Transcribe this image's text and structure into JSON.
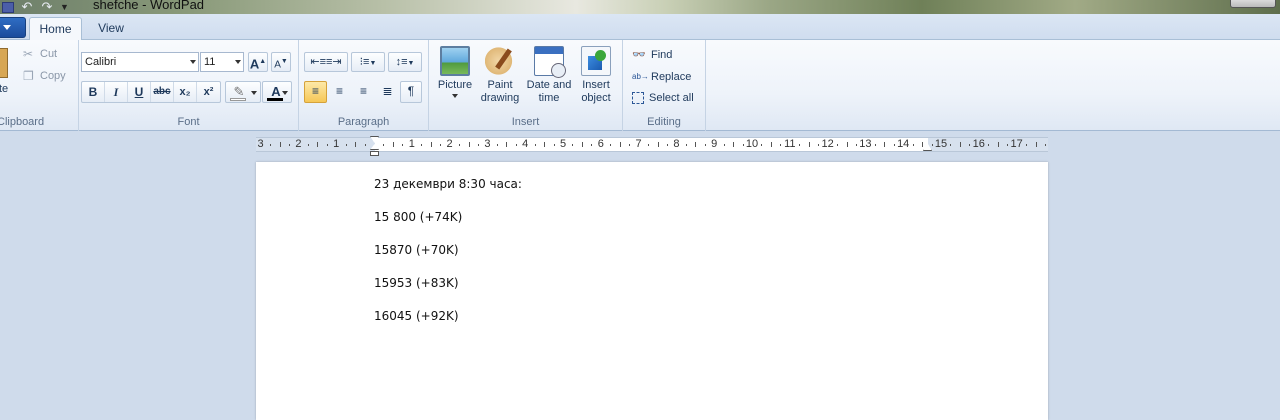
{
  "window": {
    "title": "shefche - WordPad"
  },
  "tabs": [
    {
      "label": "Home"
    },
    {
      "label": "View"
    }
  ],
  "clipboard": {
    "paste_label": "te",
    "cut_label": "Cut",
    "copy_label": "Copy",
    "group_label": "Clipboard"
  },
  "font": {
    "family_value": "Calibri",
    "size_value": "11",
    "grow_label": "A",
    "shrink_label": "A",
    "bold": "B",
    "italic": "I",
    "underline": "U",
    "strike": "abc",
    "subscript": "x₂",
    "superscript": "x²",
    "color_glyph": "A",
    "highlight_color": "#ffffff",
    "text_color": "#000000",
    "group_label": "Font"
  },
  "paragraph": {
    "group_label": "Paragraph"
  },
  "insert": {
    "picture_label_1": "Picture",
    "paint_label_1": "Paint",
    "paint_label_2": "drawing",
    "date_label_1": "Date and",
    "date_label_2": "time",
    "object_label_1": "Insert",
    "object_label_2": "object",
    "group_label": "Insert"
  },
  "editing": {
    "find_label": "Find",
    "replace_label": "Replace",
    "select_all_label": "Select all",
    "group_label": "Editing"
  },
  "ruler": {
    "numbers": [
      "3",
      "2",
      "1",
      "1",
      "2",
      "3",
      "4",
      "5",
      "6",
      "7",
      "8",
      "9",
      "10",
      "11",
      "12",
      "13",
      "14",
      "15",
      "16",
      "17"
    ]
  },
  "document": {
    "lines": [
      "23 декември 8:30 часа:",
      "15 800 (+74K)",
      "15870 (+70K)",
      "15953 (+83K)",
      "16045 (+92K)"
    ]
  },
  "colors": {
    "accent": "#f6c757",
    "ribbon_text": "#1e395b",
    "workspace": "#cfdbeb"
  }
}
